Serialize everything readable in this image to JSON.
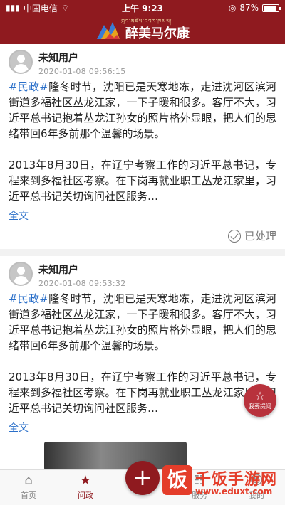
{
  "status_bar": {
    "carrier": "中国电信",
    "time": "上午 9:23",
    "battery": "87%",
    "battery_level": 0.87
  },
  "header": {
    "logo_text": "醉美马尔康",
    "logo_sub": "ཀླད་མཛེས་འབར་ཁམས།"
  },
  "posts": [
    {
      "user": "未知用户",
      "time": "2020-01-08 09:56:15",
      "hashtag": "#民政#",
      "para1": "隆冬时节，沈阳已是天寒地冻，走进沈河区滨河街道多福社区丛龙江家，一下子暖和很多。客厅不大，习近平总书记抱着丛龙江孙女的照片格外显眼，把人们的思绪带回6年多前那个温馨的场景。",
      "para2": "2013年8月30日，在辽宁考察工作的习近平总书记，专程来到多福社区考察。在下岗再就业职工丛龙江家里，习近平总书记关切询问社区服务…",
      "fulltext": "全文",
      "status": "已处理"
    },
    {
      "user": "未知用户",
      "time": "2020-01-08 09:53:32",
      "hashtag": "#民政#",
      "para1": "隆冬时节，沈阳已是天寒地冻，走进沈河区滨河街道多福社区丛龙江家，一下子暖和很多。客厅不大，习近平总书记抱着丛龙江孙女的照片格外显眼，把人们的思绪带回6年多前那个温馨的场景。",
      "para2": "2013年8月30日，在辽宁考察工作的习近平总书记，专程来到多福社区考察。在下岗再就业职工丛龙江家里，习近平总书记关切询问社区服务…",
      "fulltext": "全文"
    }
  ],
  "fab_ask": {
    "label": "我要提问"
  },
  "tabs": [
    {
      "label": "首页",
      "icon": "home-icon"
    },
    {
      "label": "问政",
      "icon": "star-icon"
    },
    {
      "label": "服务",
      "icon": "service-icon"
    },
    {
      "label": "我的",
      "icon": "user-icon"
    }
  ],
  "watermark": {
    "mark": "饭",
    "name": "千饭手游网",
    "url": "www.eduxt.com"
  }
}
